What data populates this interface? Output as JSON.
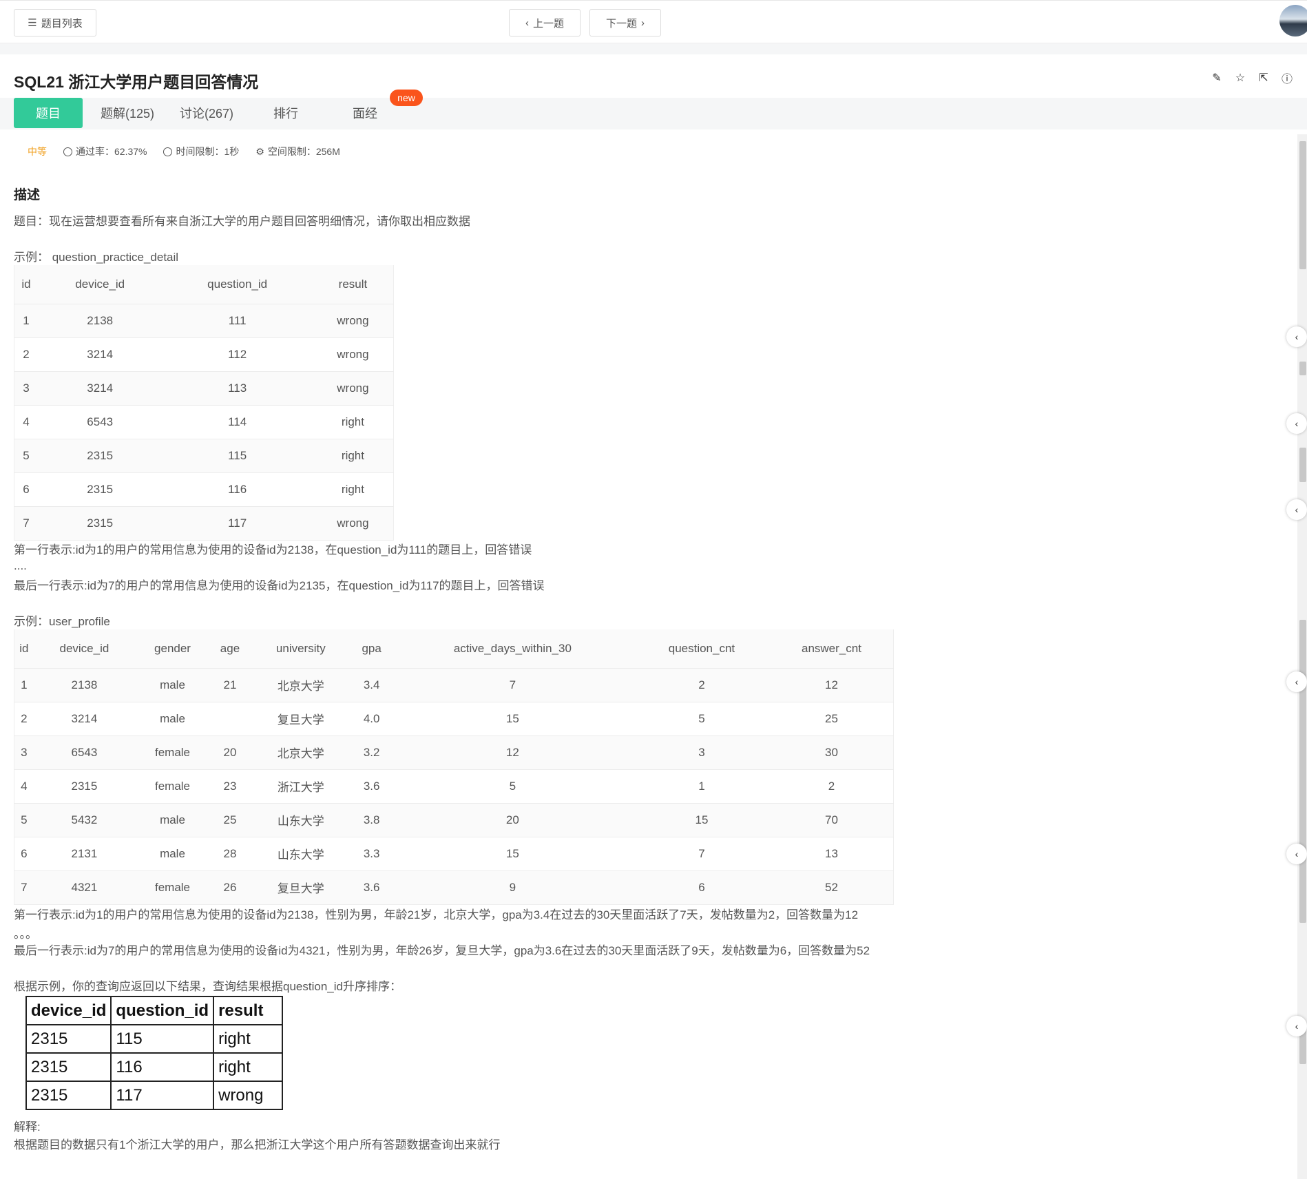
{
  "nav": {
    "list_label": "题目列表",
    "prev_label": "上一题",
    "next_label": "下一题"
  },
  "problem": {
    "title": "SQL21  浙江大学用户题目回答情况",
    "difficulty": "中等",
    "pass_rate": "通过率：62.37%",
    "time_limit": "时间限制：1秒",
    "memory_limit": "空间限制：256M"
  },
  "tabs": [
    {
      "label": "题目"
    },
    {
      "label": "题解(125)"
    },
    {
      "label": "讨论(267)"
    },
    {
      "label": "排行"
    },
    {
      "label": "面经"
    }
  ],
  "new_badge": "new",
  "description": {
    "heading": "描述",
    "intro": "题目：现在运营想要查看所有来自浙江大学的用户题目回答明细情况，请你取出相应数据",
    "example1_label": "示例： question_practice_detail",
    "table1": {
      "headers": [
        "id",
        "device_id",
        "question_id",
        "result"
      ],
      "rows": [
        [
          "1",
          "2138",
          "111",
          "wrong"
        ],
        [
          "2",
          "3214",
          "112",
          "wrong"
        ],
        [
          "3",
          "3214",
          "113",
          "wrong"
        ],
        [
          "4",
          "6543",
          "114",
          "right"
        ],
        [
          "5",
          "2315",
          "115",
          "right"
        ],
        [
          "6",
          "2315",
          "116",
          "right"
        ],
        [
          "7",
          "2315",
          "117",
          "wrong"
        ]
      ]
    },
    "note1_first": "第一行表示:id为1的用户的常用信息为使用的设备id为2138，在question_id为111的题目上，回答错误",
    "note1_dots": "....",
    "note1_last": "最后一行表示:id为7的用户的常用信息为使用的设备id为2135，在question_id为117的题目上，回答错误",
    "example2_label": "示例：user_profile",
    "table2": {
      "headers": [
        "id",
        "device_id",
        "gender",
        "age",
        "university",
        "gpa",
        "active_days_within_30",
        "question_cnt",
        "answer_cnt"
      ],
      "rows": [
        [
          "1",
          "2138",
          "male",
          "21",
          "北京大学",
          "3.4",
          "7",
          "2",
          "12"
        ],
        [
          "2",
          "3214",
          "male",
          "",
          "复旦大学",
          "4.0",
          "15",
          "5",
          "25"
        ],
        [
          "3",
          "6543",
          "female",
          "20",
          "北京大学",
          "3.2",
          "12",
          "3",
          "30"
        ],
        [
          "4",
          "2315",
          "female",
          "23",
          "浙江大学",
          "3.6",
          "5",
          "1",
          "2"
        ],
        [
          "5",
          "5432",
          "male",
          "25",
          "山东大学",
          "3.8",
          "20",
          "15",
          "70"
        ],
        [
          "6",
          "2131",
          "male",
          "28",
          "山东大学",
          "3.3",
          "15",
          "7",
          "13"
        ],
        [
          "7",
          "4321",
          "female",
          "26",
          "复旦大学",
          "3.6",
          "9",
          "6",
          "52"
        ]
      ]
    },
    "note2_first": "第一行表示:id为1的用户的常用信息为使用的设备id为2138，性别为男，年龄21岁，北京大学，gpa为3.4在过去的30天里面活跃了7天，发帖数量为2，回答数量为12",
    "note2_dots": "。。。",
    "note2_last": "最后一行表示:id为7的用户的常用信息为使用的设备id为4321，性别为男，年龄26岁，复旦大学，gpa为3.6在过去的30天里面活跃了9天，发帖数量为6，回答数量为52",
    "result_intro": "根据示例，你的查询应返回以下结果，查询结果根据question_id升序排序：",
    "result_table": {
      "headers": [
        "device_id",
        "question_id",
        "result"
      ],
      "rows": [
        [
          "2315",
          "115",
          "right"
        ],
        [
          "2315",
          "116",
          "right"
        ],
        [
          "2315",
          "117",
          "wrong"
        ]
      ]
    },
    "explain_label": "解释:",
    "explain_text": "根据题目的数据只有1个浙江大学的用户，那么把浙江大学这个用户所有答题数据查询出来就行"
  },
  "icons": [
    "list-icon",
    "chevron-left-icon",
    "chevron-right-icon",
    "edit-icon",
    "star-icon",
    "share-icon",
    "report-icon",
    "check-circle-icon",
    "clock-icon",
    "memory-icon"
  ],
  "colors": {
    "accent": "#32ca99",
    "new_badge": "#fa541c",
    "difficulty": "#f0a020"
  }
}
